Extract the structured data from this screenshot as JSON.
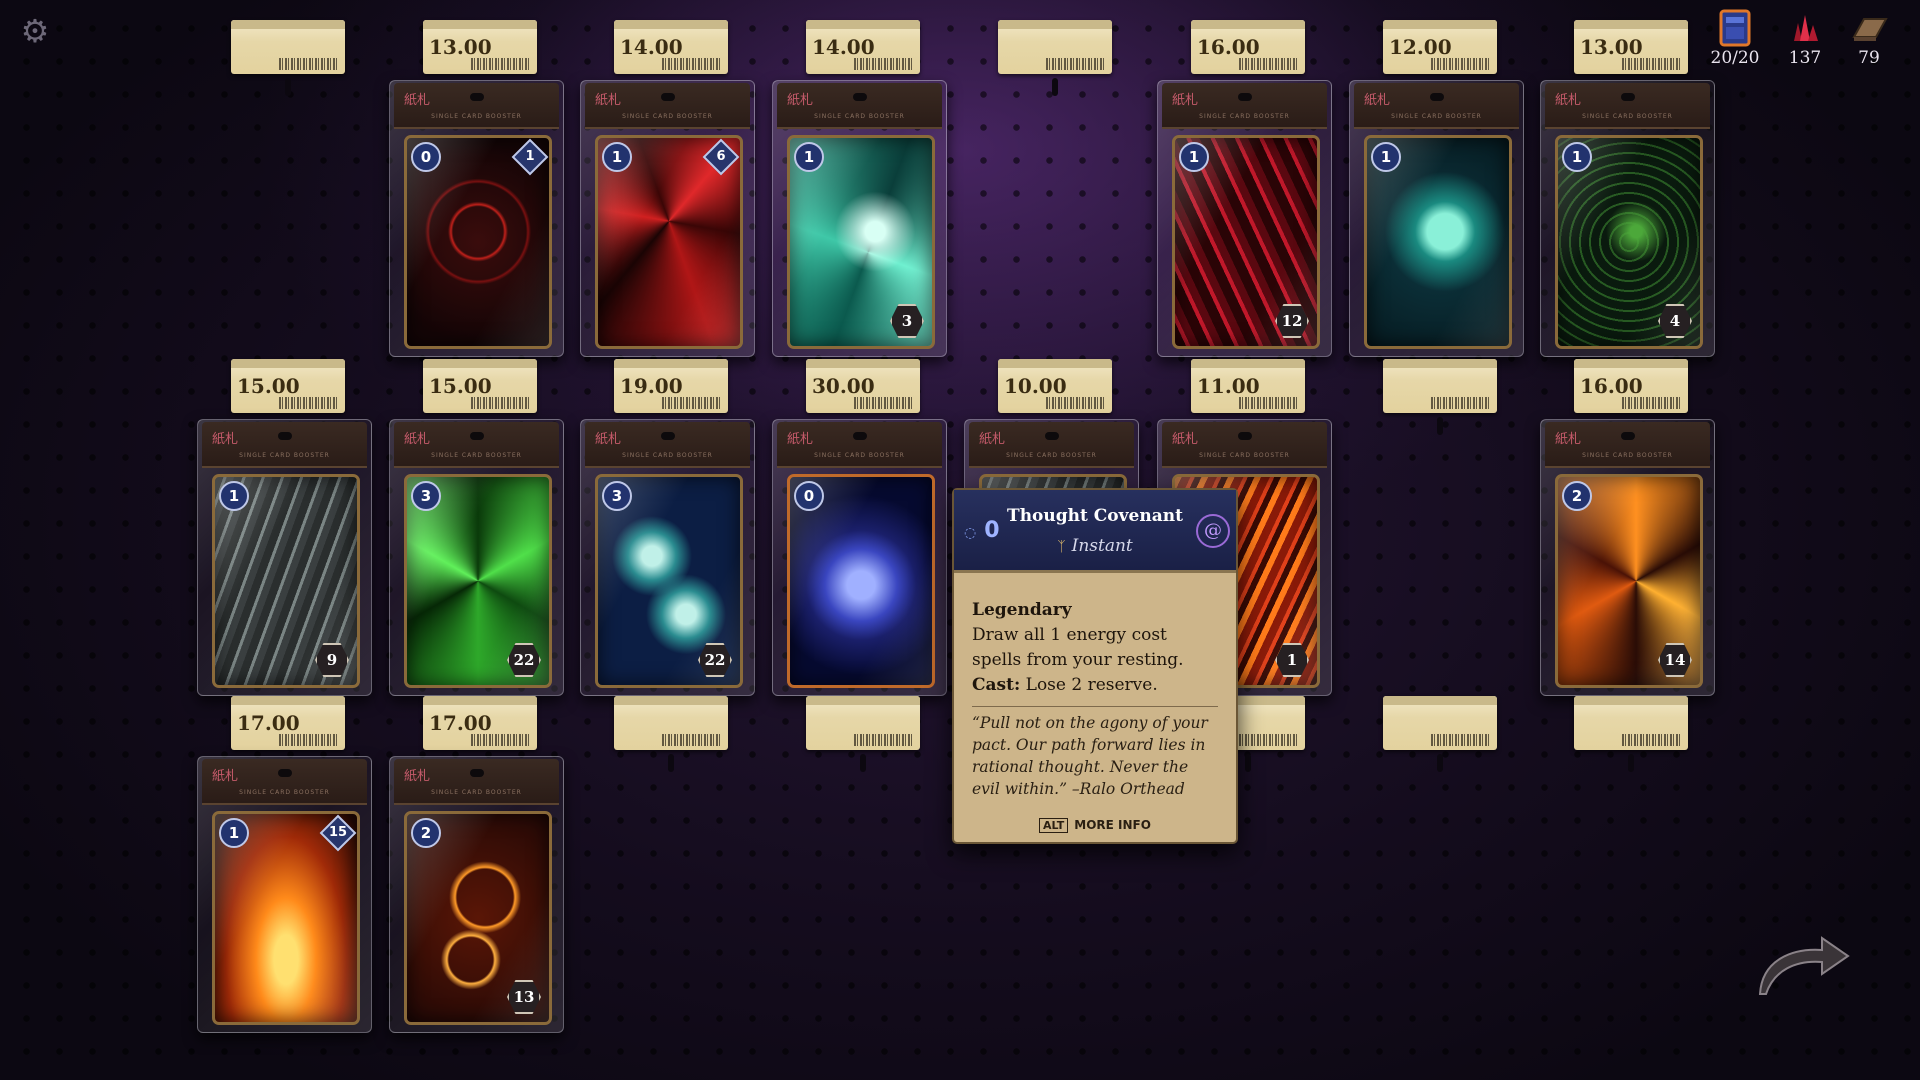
{
  "hud": {
    "deck_count": "20/20",
    "crystals": "137",
    "gold": "79"
  },
  "slots": [
    {
      "price": "",
      "card": null
    },
    {
      "price": "13.00",
      "card": {
        "cost": "0",
        "gem": "1",
        "stock": "",
        "art": "red-rune-ring",
        "style": "art-redring"
      }
    },
    {
      "price": "14.00",
      "card": {
        "cost": "1",
        "gem": "6",
        "stock": "",
        "art": "crimson-vortex-claw",
        "style": "art-redswirl"
      }
    },
    {
      "price": "14.00",
      "card": {
        "cost": "1",
        "gem": "",
        "stock": "3",
        "art": "tidal-wave",
        "style": "art-wave"
      }
    },
    {
      "price": "",
      "card": null
    },
    {
      "price": "16.00",
      "card": {
        "cost": "1",
        "gem": "",
        "stock": "12",
        "art": "blood-streak",
        "style": "art-redstreak"
      }
    },
    {
      "price": "12.00",
      "card": {
        "cost": "1",
        "gem": "",
        "stock": "",
        "art": "spectral-hand",
        "style": "art-hand"
      }
    },
    {
      "price": "13.00",
      "card": {
        "cost": "1",
        "gem": "",
        "stock": "4",
        "art": "green-vines",
        "style": "art-vine"
      }
    },
    {
      "price": "15.00",
      "card": {
        "cost": "1",
        "gem": "",
        "stock": "9",
        "art": "grey-smoke",
        "style": "art-smoke"
      }
    },
    {
      "price": "15.00",
      "card": {
        "cost": "3",
        "gem": "",
        "stock": "22",
        "art": "green-vortex",
        "style": "art-greenvortex"
      }
    },
    {
      "price": "19.00",
      "card": {
        "cost": "3",
        "gem": "",
        "stock": "22",
        "art": "twin-water-serpents",
        "style": "art-yinyang"
      }
    },
    {
      "price": "30.00",
      "card": {
        "cost": "0",
        "gem": "",
        "stock": "",
        "art": "glowing-brain",
        "style": "art-brain",
        "highlight": true
      }
    },
    {
      "price": "10.00",
      "card": {
        "cost": "",
        "gem": "",
        "stock": "",
        "art": "hidden-by-tooltip",
        "style": "art-smoke"
      }
    },
    {
      "price": "11.00",
      "card": {
        "cost": "",
        "gem": "",
        "stock": "1",
        "art": "lava-slash",
        "style": "art-lava"
      }
    },
    {
      "price": "",
      "card": null
    },
    {
      "price": "16.00",
      "card": {
        "cost": "2",
        "gem": "",
        "stock": "14",
        "art": "fire-swirl",
        "style": "art-fireswirl"
      }
    },
    {
      "price": "17.00",
      "card": {
        "cost": "1",
        "gem": "15",
        "stock": "",
        "art": "flame-burst",
        "style": "art-flames"
      }
    },
    {
      "price": "17.00",
      "card": {
        "cost": "2",
        "gem": "",
        "stock": "13",
        "art": "fire-curl",
        "style": "art-firecurl"
      }
    },
    {
      "price": "",
      "card": null
    },
    {
      "price": "",
      "card": null
    },
    {
      "price": "",
      "card": null
    },
    {
      "price": "",
      "card": null
    },
    {
      "price": "",
      "card": null
    },
    {
      "price": "",
      "card": null
    }
  ],
  "pack_header": {
    "brand": "紙札",
    "subtitle": "SINGLE CARD BOOSTER"
  },
  "tooltip": {
    "cost": "0",
    "name": "Thought Covenant",
    "type": "Instant",
    "keyword": "Legendary",
    "line1": "Draw all 1 energy cost spells from your resting.",
    "cast_label": "Cast:",
    "cast_text": " Lose 2 reserve.",
    "flavor": "“Pull not on the agony of your pact. Our path forward lies in rational thought. Never the evil within.” –Ralo Orthead",
    "more_key": "ALT",
    "more_label": "MORE INFO"
  },
  "icons": {
    "settings": "gear-icon",
    "deck": "deck-box-icon",
    "crystals": "crystal-icon",
    "gold": "gold-bar-icon",
    "next": "next-arrow-icon"
  },
  "colors": {
    "cost_badge": "#22336e",
    "price_tag": "#e6d7a8",
    "tooltip_header": "#27305e",
    "tooltip_body": "#cdb58a"
  }
}
